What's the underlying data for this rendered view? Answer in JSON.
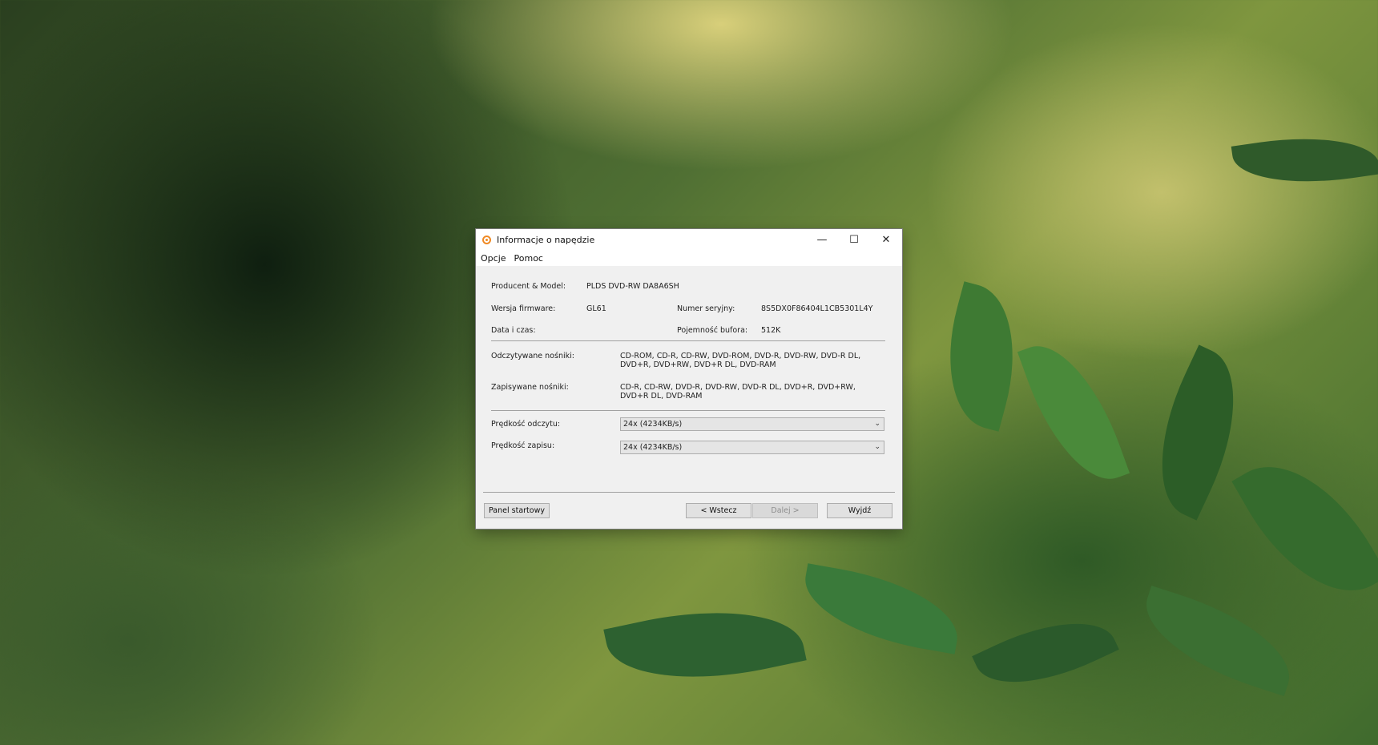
{
  "window": {
    "title": "Informacje o napędzie"
  },
  "menu": [
    "Opcje",
    "Pomoc"
  ],
  "info": {
    "producer_label": "Producent & Model:",
    "producer_value": "PLDS DVD-RW DA8A6SH",
    "firmware_label": "Wersja firmware:",
    "firmware_value": "GL61",
    "serial_label": "Numer seryjny:",
    "serial_value": "8S5DX0F86404L1CB5301L4Y",
    "datetime_label": "Data i czas:",
    "buffer_label": "Pojemność bufora:",
    "buffer_value": "512K"
  },
  "media": {
    "read_label": "Odczytywane nośniki:",
    "read_value": "CD-ROM, CD-R, CD-RW, DVD-ROM, DVD-R, DVD-RW, DVD-R DL, DVD+R, DVD+RW, DVD+R DL, DVD-RAM",
    "write_label": "Zapisywane nośniki:",
    "write_value": "CD-R, CD-RW, DVD-R, DVD-RW, DVD-R DL, DVD+R, DVD+RW, DVD+R DL, DVD-RAM"
  },
  "speeds": {
    "read_label": "Prędkość odczytu:",
    "read_value": "24x (4234KB/s)",
    "write_label": "Prędkość zapisu:",
    "write_value": "24x (4234KB/s)"
  },
  "buttons": {
    "start_panel": "Panel startowy",
    "back": "< Wstecz",
    "next": "Dalej >",
    "exit": "Wyjdź"
  }
}
